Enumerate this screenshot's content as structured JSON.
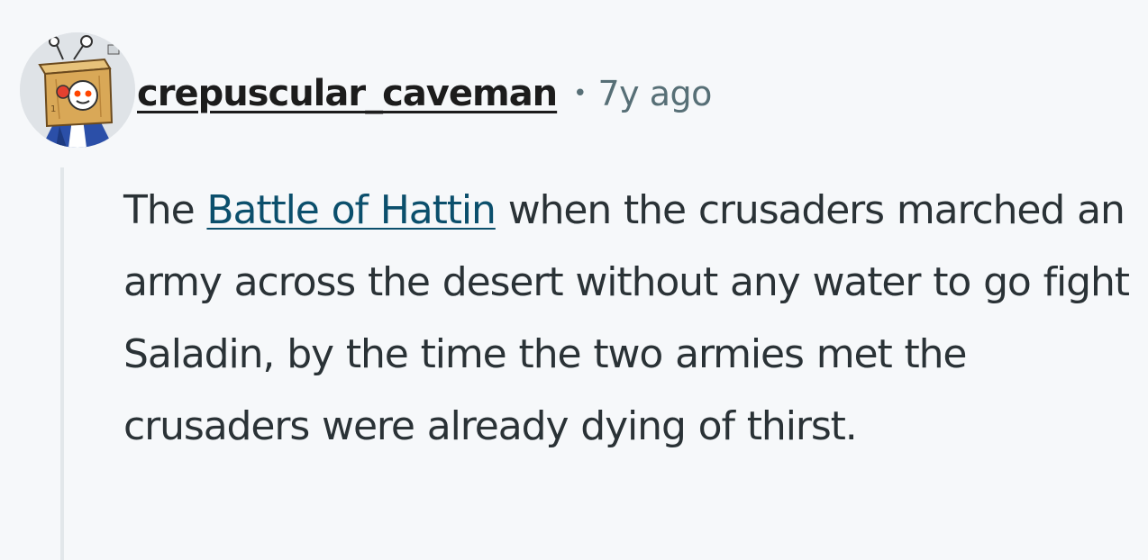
{
  "comment": {
    "author": "crepuscular_caveman",
    "separator": "•",
    "timestamp": "7y ago",
    "avatar_icon": "snoo-box-costume-avatar",
    "body": {
      "prefix": "The ",
      "link_text": "Battle of Hattin",
      "suffix": " when the crusaders marched an army across the desert without any water to go fight Saladin, by the time the two armies met the crusaders were already dying of thirst."
    }
  },
  "colors": {
    "background": "#f6f8fa",
    "text": "#2a3236",
    "meta_text": "#576f76",
    "link": "#0b4f6c",
    "thread_line": "#e2e7ea"
  }
}
